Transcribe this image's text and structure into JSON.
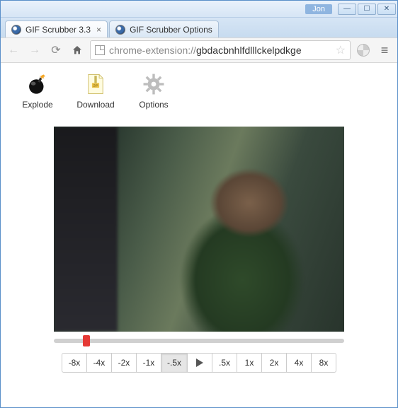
{
  "window": {
    "user": "Jon"
  },
  "tabs": [
    {
      "title": "GIF Scrubber 3.3",
      "active": true
    },
    {
      "title": "GIF Scrubber Options",
      "active": false
    }
  ],
  "omnibox": {
    "scheme": "chrome-extension://",
    "path": "gbdacbnhlfdlllckelpdkge"
  },
  "actions": {
    "explode": "Explode",
    "download": "Download",
    "options": "Options"
  },
  "scrubber": {
    "position_pct": 10
  },
  "speeds": {
    "buttons": [
      "-8x",
      "-4x",
      "-2x",
      "-1x",
      "-.5x",
      "play",
      ".5x",
      "1x",
      "2x",
      "4x",
      "8x"
    ],
    "active": "-.5x"
  }
}
